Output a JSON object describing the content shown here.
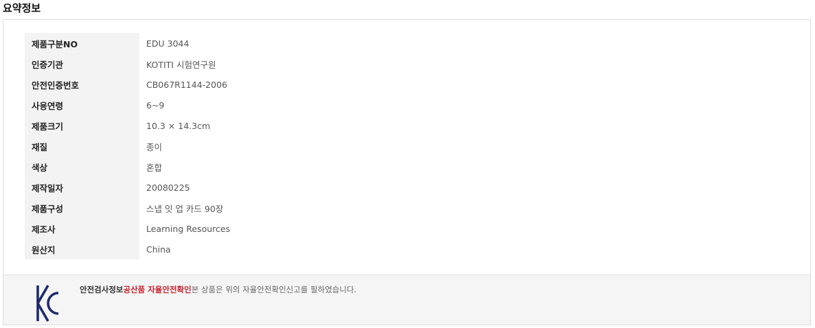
{
  "section_title": "요약정보",
  "specs": [
    {
      "label": "제품구분NO",
      "value": "EDU 3044"
    },
    {
      "label": "인증기관",
      "value": "KOTITI 시험연구원"
    },
    {
      "label": "안전인증번호",
      "value": "CB067R1144-2006"
    },
    {
      "label": "사용연령",
      "value": "6~9"
    },
    {
      "label": "제품크기",
      "value": "10.3 × 14.3cm"
    },
    {
      "label": "재질",
      "value": "종이"
    },
    {
      "label": "색상",
      "value": "혼합"
    },
    {
      "label": "제작일자",
      "value": "20080225"
    },
    {
      "label": "제품구성",
      "value": "스냅 잇 업 카드 90장"
    },
    {
      "label": "제조사",
      "value": "Learning Resources"
    },
    {
      "label": "원산지",
      "value": "China"
    }
  ],
  "kc": {
    "title": "안전검사정보",
    "highlight": "공산품 자율안전확인",
    "description": "본 상품은 위의 자율안전확인신고를 필하였습니다.",
    "logo_color": "#1d2a6b"
  }
}
